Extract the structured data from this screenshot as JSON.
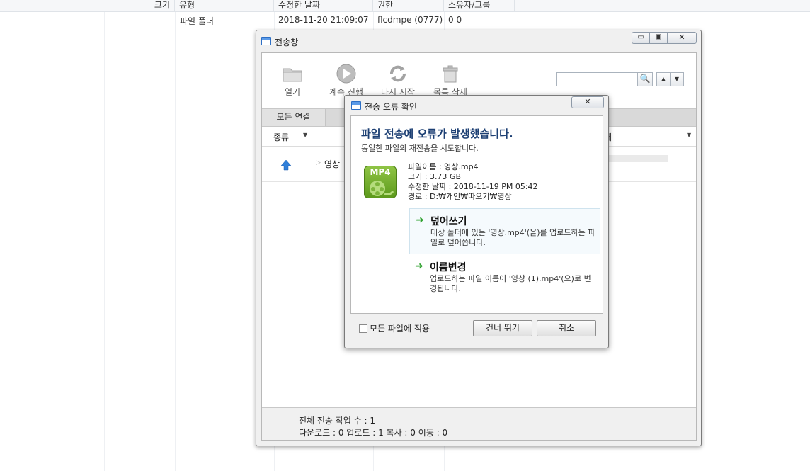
{
  "file_list": {
    "columns": [
      "크기",
      "유형",
      "수정한 날짜",
      "권한",
      "소유자/그룹"
    ],
    "row": {
      "type": "파일 폴더",
      "modified": "2018-11-20 21:09:07",
      "permission": "flcdmpe (0777)",
      "owner_group": "0 0"
    }
  },
  "transfer_window": {
    "title": "전송창",
    "caption_buttons": {
      "minimize": "▭",
      "maximize": "▣",
      "close": "✕"
    },
    "toolbar": [
      {
        "label": "열기",
        "icon": "folder-icon"
      },
      {
        "label": "계속 진행",
        "icon": "play-icon"
      },
      {
        "label": "다시 시작",
        "icon": "refresh-icon"
      },
      {
        "label": "목록 삭제",
        "icon": "trash-icon"
      }
    ],
    "search": {
      "placeholder": "",
      "button_icon": "🔍"
    },
    "nav_arrows": {
      "up": "▲",
      "down": "▼"
    },
    "tab_all": "모든 연결",
    "column_kind": "종류",
    "column_state_fragment": "태",
    "transfer_row": {
      "name": "영상",
      "direction_icon": "upload-arrow-icon"
    },
    "status": {
      "line1": "전체 전송 작업 수 : 1",
      "line2": "다운로드 : 0  업로드 : 1  복사 : 0  이동 : 0"
    }
  },
  "error_dialog": {
    "title": "전송 오류 확인",
    "close_label": "✕",
    "heading": "파일 전송에 오류가 발생했습니다.",
    "subheading": "동일한 파일의 재전송을 시도합니다.",
    "file_icon_label": "MP4",
    "file_info": {
      "name": "파일이름 : 영상.mp4",
      "size": "크기 : 3.73 GB",
      "modified": "수정한 날짜 : 2018-11-19 PM 05:42",
      "path": "경로 : D:₩개인₩따오기₩영상"
    },
    "options": [
      {
        "title": "덮어쓰기",
        "desc": "대상 폴더에 있는 '영상.mp4'(을)를 업로드하는 파일로 덮어씁니다."
      },
      {
        "title": "이름변경",
        "desc": "업로드하는 파일 이름이 '영상 (1).mp4'(으)로 변경됩니다."
      }
    ],
    "apply_all": "모든 파일에 적용",
    "buttons": {
      "skip": "건너 뛰기",
      "cancel": "취소"
    },
    "colors": {
      "heading": "#1c3f73",
      "arrow": "#2ea12e",
      "mp4_icon": "#6fae27"
    }
  }
}
